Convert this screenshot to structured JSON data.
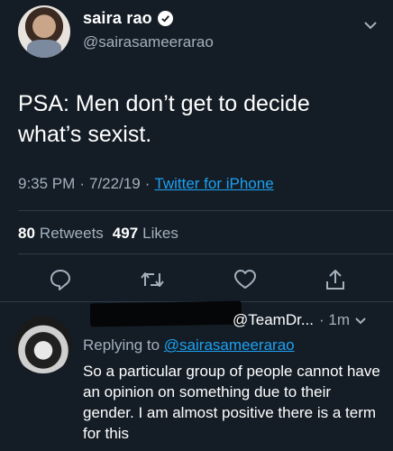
{
  "tweet": {
    "display_name": "saira rao",
    "handle": "@sairasameerarao",
    "text": "PSA: Men don’t get to decide what’s sexist.",
    "time": "9:35 PM",
    "date": "7/22/19",
    "separator": "·",
    "source": "Twitter for iPhone",
    "retweets_count": "80",
    "retweets_label": "Retweets",
    "likes_count": "497",
    "likes_label": "Likes"
  },
  "reply": {
    "handle": "@TeamDr...",
    "time": "· 1m",
    "replying_prefix": "Replying to",
    "replying_to": "@sairasameerarao",
    "text": "So a particular group of people cannot have an opinion on something due to their gender. I am almost positive there is a term for this"
  },
  "icons": {
    "verified": "verified-badge-icon",
    "chevron": "chevron-down-icon",
    "reply": "reply-icon",
    "retweet": "retweet-icon",
    "like": "heart-icon",
    "share": "share-icon"
  },
  "colors": {
    "background": "#141d26",
    "accent": "#1da1f2",
    "secondary_text": "#a3b0bd"
  }
}
